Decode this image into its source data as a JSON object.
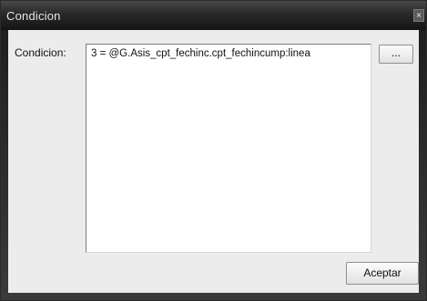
{
  "window": {
    "title": "Condicion",
    "close_glyph": "×"
  },
  "form": {
    "condition_label": "Condicion:",
    "condition_value": "3 = @G.Asis_cpt_fechinc.cpt_fechincump:linea",
    "browse_label": "..."
  },
  "footer": {
    "accept_label": "Aceptar"
  }
}
